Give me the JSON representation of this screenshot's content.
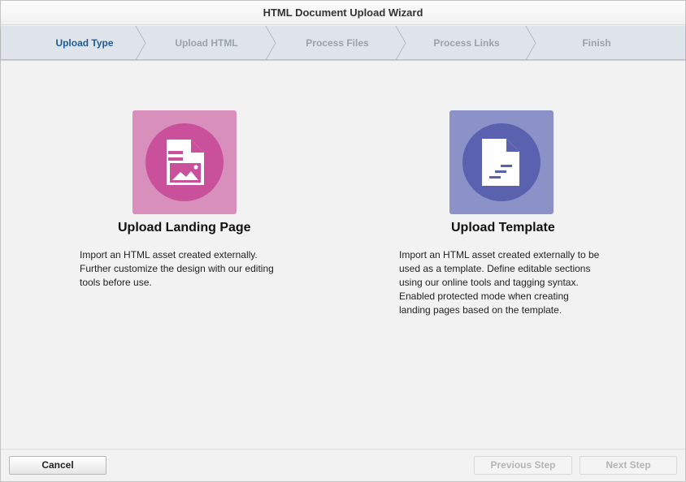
{
  "window": {
    "title": "HTML Document Upload Wizard"
  },
  "steps": [
    {
      "label": "Upload Type",
      "active": true
    },
    {
      "label": "Upload HTML",
      "active": false
    },
    {
      "label": "Process Files",
      "active": false
    },
    {
      "label": "Process Links",
      "active": false
    },
    {
      "label": "Finish",
      "active": false
    }
  ],
  "options": {
    "landing": {
      "title": "Upload Landing Page",
      "description": "Import an HTML asset created externally.\nFurther customize the design with our editing\ntools before use.",
      "icon": "landing-page-document-icon",
      "tile_color": "#d98fbc",
      "circle_color": "#c9509a"
    },
    "template": {
      "title": "Upload Template",
      "description": "Import an HTML asset created externally to be\nused as a template. Define editable sections\nusing our online tools and tagging syntax.\nEnabled protected mode when creating\nlanding pages based on the template.",
      "icon": "template-document-icon",
      "tile_color": "#8c92c8",
      "circle_color": "#5a62b0"
    }
  },
  "footer": {
    "cancel_label": "Cancel",
    "previous_label": "Previous Step",
    "next_label": "Next Step"
  },
  "colors": {
    "active_step": "#1c5a98",
    "inactive_step": "#9ba2aa"
  }
}
